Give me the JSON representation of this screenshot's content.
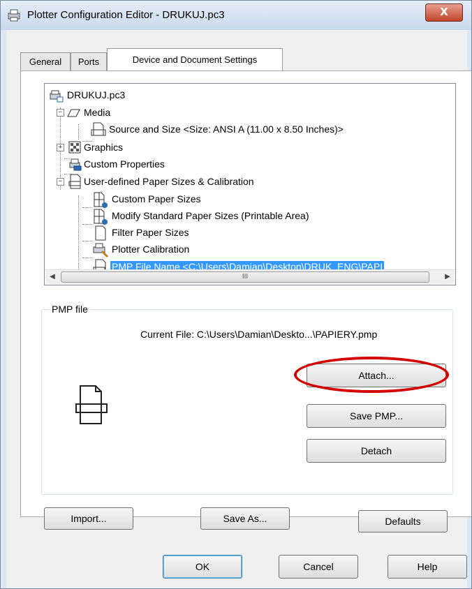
{
  "window": {
    "title": "Plotter Configuration Editor - DRUKUJ.pc3",
    "close_glyph": "X"
  },
  "tabs": [
    {
      "label": "General"
    },
    {
      "label": "Ports"
    },
    {
      "label": "Device and Document Settings",
      "active": true
    }
  ],
  "tree": {
    "root": "DRUKUJ.pc3",
    "items": [
      "Media",
      "Source and Size <Size: ANSI A (11.00 x 8.50 Inches)>",
      "Graphics",
      "Custom Properties",
      "User-defined Paper Sizes & Calibration",
      "Custom Paper Sizes",
      "Modify Standard Paper Sizes (Printable Area)",
      "Filter Paper Sizes",
      "Plotter Calibration",
      "PMP File Name <C:\\Users\\Damian\\Desktop\\DRUK_ENG\\PAPI"
    ],
    "selected_index": 9,
    "expander_minus": "−",
    "expander_plus": "+",
    "scroll_left": "◀",
    "scroll_right": "▶",
    "scroll_grip": "III"
  },
  "pmp_group": {
    "label": "PMP file",
    "current_file": "Current File: C:\\Users\\Damian\\Deskto...\\PAPIERY.pmp",
    "attach_label": "Attach...",
    "save_pmp_label": "Save PMP...",
    "detach_label": "Detach"
  },
  "bottom": {
    "import_label": "Import...",
    "save_as_label": "Save As...",
    "defaults_label": "Defaults"
  },
  "footer": {
    "ok_label": "OK",
    "cancel_label": "Cancel",
    "help_label": "Help"
  },
  "colors": {
    "selection": "#3399ff",
    "highlight_ellipse": "#d40000",
    "title_bar": "#c8d9ee"
  }
}
